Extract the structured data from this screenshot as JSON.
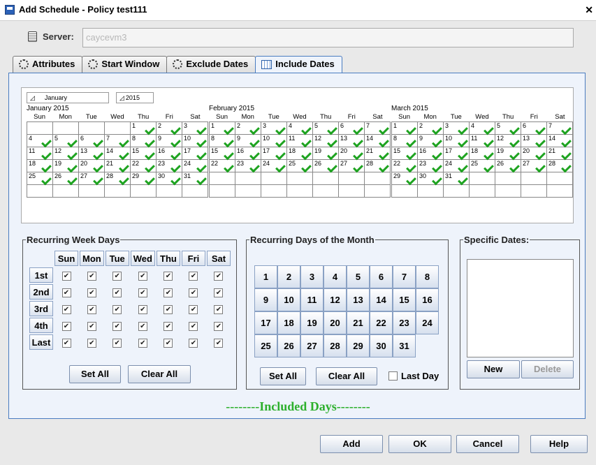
{
  "window": {
    "title": "Add Schedule - Policy test111",
    "close_glyph": "✕"
  },
  "server": {
    "label": "Server:",
    "value": "caycevm3"
  },
  "tabs": [
    {
      "label": "Attributes",
      "icon": "gear-icon"
    },
    {
      "label": "Start Window",
      "icon": "gear-icon"
    },
    {
      "label": "Exclude Dates",
      "icon": "gear-icon"
    },
    {
      "label": "Include Dates",
      "icon": "calendar-icon",
      "active": true
    }
  ],
  "calendar": {
    "month_select": "January",
    "year_select": "2015",
    "weekday_headers": [
      "Sun",
      "Mon",
      "Tue",
      "Wed",
      "Thu",
      "Fri",
      "Sat"
    ],
    "months": [
      {
        "title": "January 2015",
        "first_weekday": 4,
        "days": 31
      },
      {
        "title": "February 2015",
        "first_weekday": 0,
        "days": 28
      },
      {
        "title": "March 2015",
        "first_weekday": 0,
        "days": 31
      }
    ],
    "check_color": "#1ea320"
  },
  "recurring_week_days": {
    "legend": "Recurring Week Days",
    "columns": [
      "Sun",
      "Mon",
      "Tue",
      "Wed",
      "Thu",
      "Fri",
      "Sat"
    ],
    "rows": [
      "1st",
      "2nd",
      "3rd",
      "4th",
      "Last"
    ],
    "check_glyph": "✔",
    "set_all": "Set All",
    "clear_all": "Clear All"
  },
  "recurring_days_month": {
    "legend": "Recurring Days of the Month",
    "days": [
      "1",
      "2",
      "3",
      "4",
      "5",
      "6",
      "7",
      "8",
      "9",
      "10",
      "11",
      "12",
      "13",
      "14",
      "15",
      "16",
      "17",
      "18",
      "19",
      "20",
      "21",
      "22",
      "23",
      "24",
      "25",
      "26",
      "27",
      "28",
      "29",
      "30",
      "31"
    ],
    "set_all": "Set All",
    "clear_all": "Clear All",
    "last_day": "Last Day"
  },
  "specific_dates": {
    "legend": "Specific Dates:",
    "new": "New",
    "delete": "Delete"
  },
  "included_days_label": "--------Included Days--------",
  "buttons": {
    "add": "Add",
    "ok": "OK",
    "cancel": "Cancel",
    "help": "Help"
  }
}
